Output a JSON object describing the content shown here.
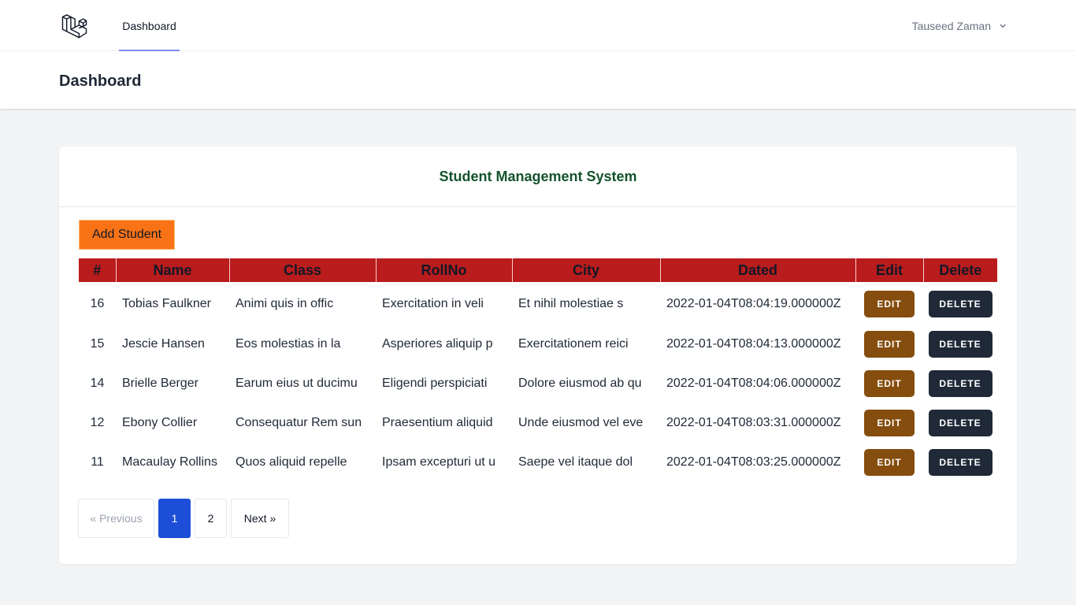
{
  "nav": {
    "logo_icon": "laravel-logo-icon",
    "dashboard_link": "Dashboard",
    "user_name": "Tauseed Zaman",
    "user_dropdown_icon": "chevron-down-icon"
  },
  "header": {
    "title": "Dashboard"
  },
  "card": {
    "title": "Student Management System",
    "add_button": "Add Student"
  },
  "table": {
    "columns": [
      "#",
      "Name",
      "Class",
      "RollNo",
      "City",
      "Dated",
      "Edit",
      "Delete"
    ],
    "rows": [
      {
        "id": "16",
        "name": "Tobias Faulkner",
        "class": "Animi quis in offic",
        "rollno": "Exercitation in veli",
        "city": "Et nihil molestiae s",
        "dated": "2022-01-04T08:04:19.000000Z",
        "edit": "EDIT",
        "delete": "DELETE"
      },
      {
        "id": "15",
        "name": "Jescie Hansen",
        "class": "Eos molestias in la",
        "rollno": "Asperiores aliquip p",
        "city": "Exercitationem reici",
        "dated": "2022-01-04T08:04:13.000000Z",
        "edit": "EDIT",
        "delete": "DELETE"
      },
      {
        "id": "14",
        "name": "Brielle Berger",
        "class": "Earum eius ut ducimu",
        "rollno": "Eligendi perspiciati",
        "city": "Dolore eiusmod ab qu",
        "dated": "2022-01-04T08:04:06.000000Z",
        "edit": "EDIT",
        "delete": "DELETE"
      },
      {
        "id": "12",
        "name": "Ebony Collier",
        "class": "Consequatur Rem sun",
        "rollno": "Praesentium aliquid",
        "city": "Unde eiusmod vel eve",
        "dated": "2022-01-04T08:03:31.000000Z",
        "edit": "EDIT",
        "delete": "DELETE"
      },
      {
        "id": "11",
        "name": "Macaulay Rollins",
        "class": "Quos aliquid repelle",
        "rollno": "Ipsam excepturi ut u",
        "city": "Saepe vel itaque dol",
        "dated": "2022-01-04T08:03:25.000000Z",
        "edit": "EDIT",
        "delete": "DELETE"
      }
    ]
  },
  "pagination": {
    "previous": "« Previous",
    "pages": [
      "1",
      "2"
    ],
    "current_page": "1",
    "next": "Next »"
  },
  "colors": {
    "table_header": "#b91c1c",
    "add_button": "#f97316",
    "edit_button": "#854d0e",
    "delete_button": "#1f2937",
    "active_page": "#1d4ed8",
    "card_title": "#14532d"
  }
}
